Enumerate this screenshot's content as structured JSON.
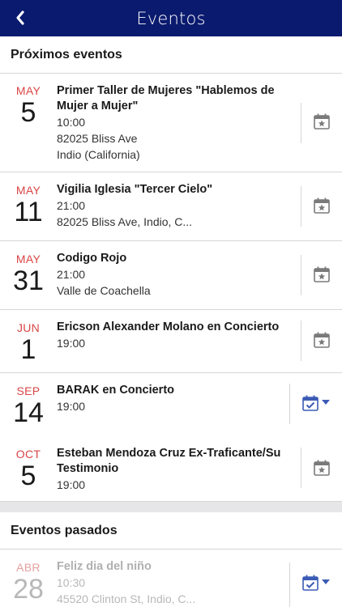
{
  "nav": {
    "title": "Eventos"
  },
  "upcoming_header": "Próximos eventos",
  "past_header": "Eventos pasados",
  "events": [
    {
      "month": "MAY",
      "day": "5",
      "name_l1": "Primer Taller de Mujeres \"Hablemos de",
      "name_l2": "Mujer a Mujer\"",
      "l1": "10:00",
      "l2": "82025 Bliss Ave",
      "l3": "Indio (California)"
    },
    {
      "month": "MAY",
      "day": "11",
      "name_l1": "Vigilia Iglesia \"Tercer Cielo\"",
      "l1": "21:00",
      "l2": "82025 Bliss Ave, Indio, C..."
    },
    {
      "month": "MAY",
      "day": "31",
      "name_l1": "Codigo Rojo",
      "l1": "21:00",
      "l2": "Valle de Coachella"
    },
    {
      "month": "JUN",
      "day": "1",
      "name_l1": "Ericson Alexander Molano en Concierto",
      "l1": "19:00"
    },
    {
      "month": "SEP",
      "day": "14",
      "name_l1": "BARAK en Concierto",
      "l1": "19:00"
    },
    {
      "month": "OCT",
      "day": "5",
      "name_l1": "Esteban Mendoza Cruz Ex-Traficante/Su",
      "name_l2": "Testimonio",
      "l1": "19:00"
    }
  ],
  "past_events": [
    {
      "month": "ABR",
      "day": "28",
      "name_l1": "Feliz dia del niño",
      "l1": "10:30",
      "l2": "45520 Clinton St, Indio, C..."
    }
  ],
  "colors": {
    "nav": "#0a1a6e",
    "accent": "#3b5bb5",
    "month": "#d94545"
  }
}
